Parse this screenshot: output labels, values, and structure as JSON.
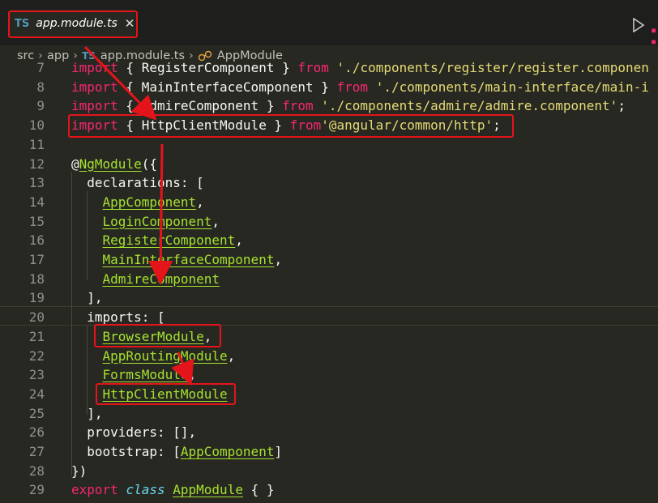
{
  "tab": {
    "ts_badge": "TS",
    "filename": "app.module.ts",
    "close": "✕"
  },
  "breadcrumb": {
    "parts": [
      "src",
      "app",
      "app.module.ts",
      "AppModule"
    ],
    "ts_badge": "TS",
    "separator": "›"
  },
  "lines": [
    {
      "num": "7",
      "tokens": [
        [
          "kw",
          "import"
        ],
        [
          "p",
          " { "
        ],
        [
          "p",
          "RegisterComponent"
        ],
        [
          "p",
          " } "
        ],
        [
          "kw",
          "from"
        ],
        [
          "p",
          " "
        ],
        [
          "str",
          "'./components/register/register.componen"
        ]
      ]
    },
    {
      "num": "8",
      "tokens": [
        [
          "kw",
          "import"
        ],
        [
          "p",
          " { MainInterfaceComponent } "
        ],
        [
          "kw",
          "from"
        ],
        [
          "p",
          " "
        ],
        [
          "str",
          "'./components/main-interface/main-i"
        ]
      ]
    },
    {
      "num": "9",
      "tokens": [
        [
          "kw",
          "import"
        ],
        [
          "p",
          " { AdmireComponent } "
        ],
        [
          "kw",
          "from"
        ],
        [
          "p",
          " "
        ],
        [
          "str",
          "'./components/admire/admire.component'"
        ],
        [
          "p",
          ";"
        ]
      ]
    },
    {
      "num": "10",
      "tokens": [
        [
          "kw",
          "import"
        ],
        [
          "p",
          " { HttpClientModule } "
        ],
        [
          "kw",
          "from"
        ],
        [
          "str",
          "'@angular/common/http'"
        ],
        [
          "p",
          ";"
        ]
      ]
    },
    {
      "num": "11",
      "tokens": []
    },
    {
      "num": "12",
      "tokens": [
        [
          "p",
          "@"
        ],
        [
          "cls",
          "NgModule"
        ],
        [
          "p",
          "({"
        ]
      ]
    },
    {
      "num": "13",
      "tokens": [
        [
          "p",
          "  declarations: ["
        ]
      ]
    },
    {
      "num": "14",
      "tokens": [
        [
          "p",
          "    "
        ],
        [
          "cls",
          "AppComponent"
        ],
        [
          "p",
          ","
        ]
      ]
    },
    {
      "num": "15",
      "tokens": [
        [
          "p",
          "    "
        ],
        [
          "cls",
          "LoginComponent"
        ],
        [
          "p",
          ","
        ]
      ]
    },
    {
      "num": "16",
      "tokens": [
        [
          "p",
          "    "
        ],
        [
          "cls",
          "RegisterComponent"
        ],
        [
          "p",
          ","
        ]
      ]
    },
    {
      "num": "17",
      "tokens": [
        [
          "p",
          "    "
        ],
        [
          "cls",
          "MainInterfaceComponent"
        ],
        [
          "p",
          ","
        ]
      ]
    },
    {
      "num": "18",
      "tokens": [
        [
          "p",
          "    "
        ],
        [
          "cls",
          "AdmireComponent"
        ]
      ]
    },
    {
      "num": "19",
      "tokens": [
        [
          "p",
          "  ],"
        ]
      ]
    },
    {
      "num": "20",
      "tokens": [
        [
          "p",
          "  imports: ["
        ]
      ]
    },
    {
      "num": "21",
      "tokens": [
        [
          "p",
          "    "
        ],
        [
          "cls",
          "BrowserModule"
        ],
        [
          "p",
          ","
        ]
      ]
    },
    {
      "num": "22",
      "tokens": [
        [
          "p",
          "    "
        ],
        [
          "cls",
          "AppRoutingModule"
        ],
        [
          "p",
          ","
        ]
      ]
    },
    {
      "num": "23",
      "tokens": [
        [
          "p",
          "    "
        ],
        [
          "cls",
          "FormsModule"
        ],
        [
          "p",
          ","
        ]
      ]
    },
    {
      "num": "24",
      "tokens": [
        [
          "p",
          "    "
        ],
        [
          "cls",
          "HttpClientModule"
        ]
      ]
    },
    {
      "num": "25",
      "tokens": [
        [
          "p",
          "  ],"
        ]
      ]
    },
    {
      "num": "26",
      "tokens": [
        [
          "p",
          "  providers: [],"
        ]
      ]
    },
    {
      "num": "27",
      "tokens": [
        [
          "p",
          "  bootstrap: ["
        ],
        [
          "cls",
          "AppComponent"
        ],
        [
          "p",
          "]"
        ]
      ]
    },
    {
      "num": "28",
      "tokens": [
        [
          "p",
          "})"
        ]
      ]
    },
    {
      "num": "29",
      "tokens": [
        [
          "exp",
          "export"
        ],
        [
          "p",
          " "
        ],
        [
          "ital",
          "class"
        ],
        [
          "p",
          " "
        ],
        [
          "cls",
          "AppModule"
        ],
        [
          "p",
          " { }"
        ]
      ]
    }
  ],
  "colors": {
    "keyword": "#f92672",
    "string": "#e6db74",
    "class": "#a6e22e",
    "annotation": "#e5141a"
  }
}
